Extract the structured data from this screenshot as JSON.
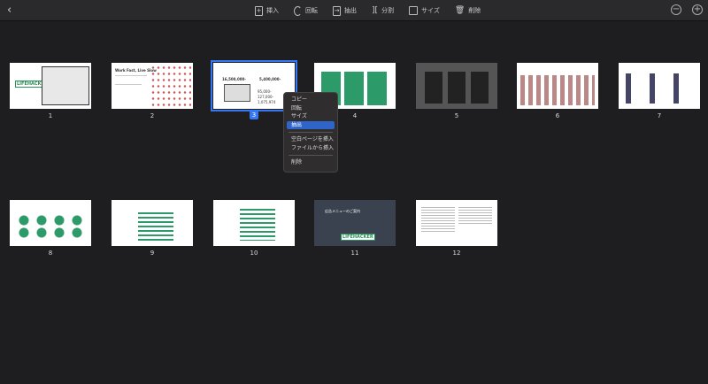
{
  "toolbar": {
    "back": "‹",
    "tools": [
      "挿入",
      "回転",
      "抽出",
      "分割",
      "サイズ",
      "削除"
    ],
    "zoom_out": "−",
    "zoom_in": "+"
  },
  "pages": [
    {
      "number": "1",
      "logo": "LIFEHACKER"
    },
    {
      "number": "2",
      "heading": "Work Fast, Live Slow"
    },
    {
      "number": "3",
      "values": [
        "16,500,000-",
        "5,400,000-",
        "95,000-",
        "127,000-",
        "1,075,974"
      ]
    },
    {
      "number": "4"
    },
    {
      "number": "5"
    },
    {
      "number": "6"
    },
    {
      "number": "7"
    },
    {
      "number": "8"
    },
    {
      "number": "9"
    },
    {
      "number": "10"
    },
    {
      "number": "11",
      "logo": "LIFEHACKER",
      "heading": "広告メニューのご案内"
    },
    {
      "number": "12"
    }
  ],
  "selected_page": "3",
  "context_menu": {
    "items": [
      "コピー",
      "回転",
      "サイズ",
      "抽出",
      "空白ページを挿入",
      "ファイルから挿入",
      "削除"
    ],
    "highlighted": "抽出"
  }
}
